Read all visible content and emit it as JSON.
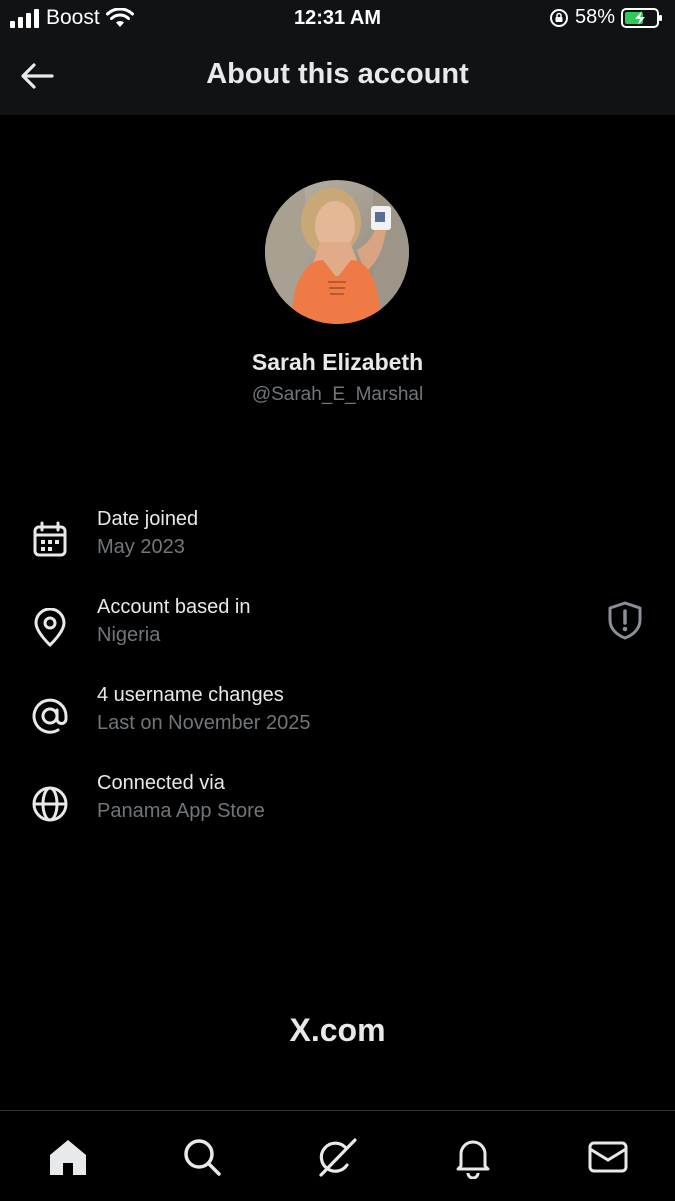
{
  "status_bar": {
    "carrier": "Boost",
    "time": "12:31 AM",
    "battery_percent": "58%"
  },
  "header": {
    "title": "About this account",
    "back_icon": "arrow-left-icon"
  },
  "profile": {
    "display_name": "Sarah Elizabeth",
    "handle": "@Sarah_E_Marshal"
  },
  "info": [
    {
      "icon": "calendar-icon",
      "label": "Date joined",
      "value": "May 2023"
    },
    {
      "icon": "location-pin-icon",
      "label": "Account based in",
      "value": "Nigeria"
    },
    {
      "icon": "at-icon",
      "label": "4 username changes",
      "value": "Last on November 2025"
    },
    {
      "icon": "globe-icon",
      "label": "Connected via",
      "value": "Panama App Store"
    }
  ],
  "brand": "X.com",
  "bottom_nav": [
    "home-icon",
    "search-icon",
    "grok-icon",
    "notifications-icon",
    "messages-icon"
  ],
  "colors": {
    "background": "#000000",
    "header_background": "#111214",
    "primary_text": "#e7e9ea",
    "secondary_text": "#71767b",
    "battery_green": "#34c759"
  }
}
